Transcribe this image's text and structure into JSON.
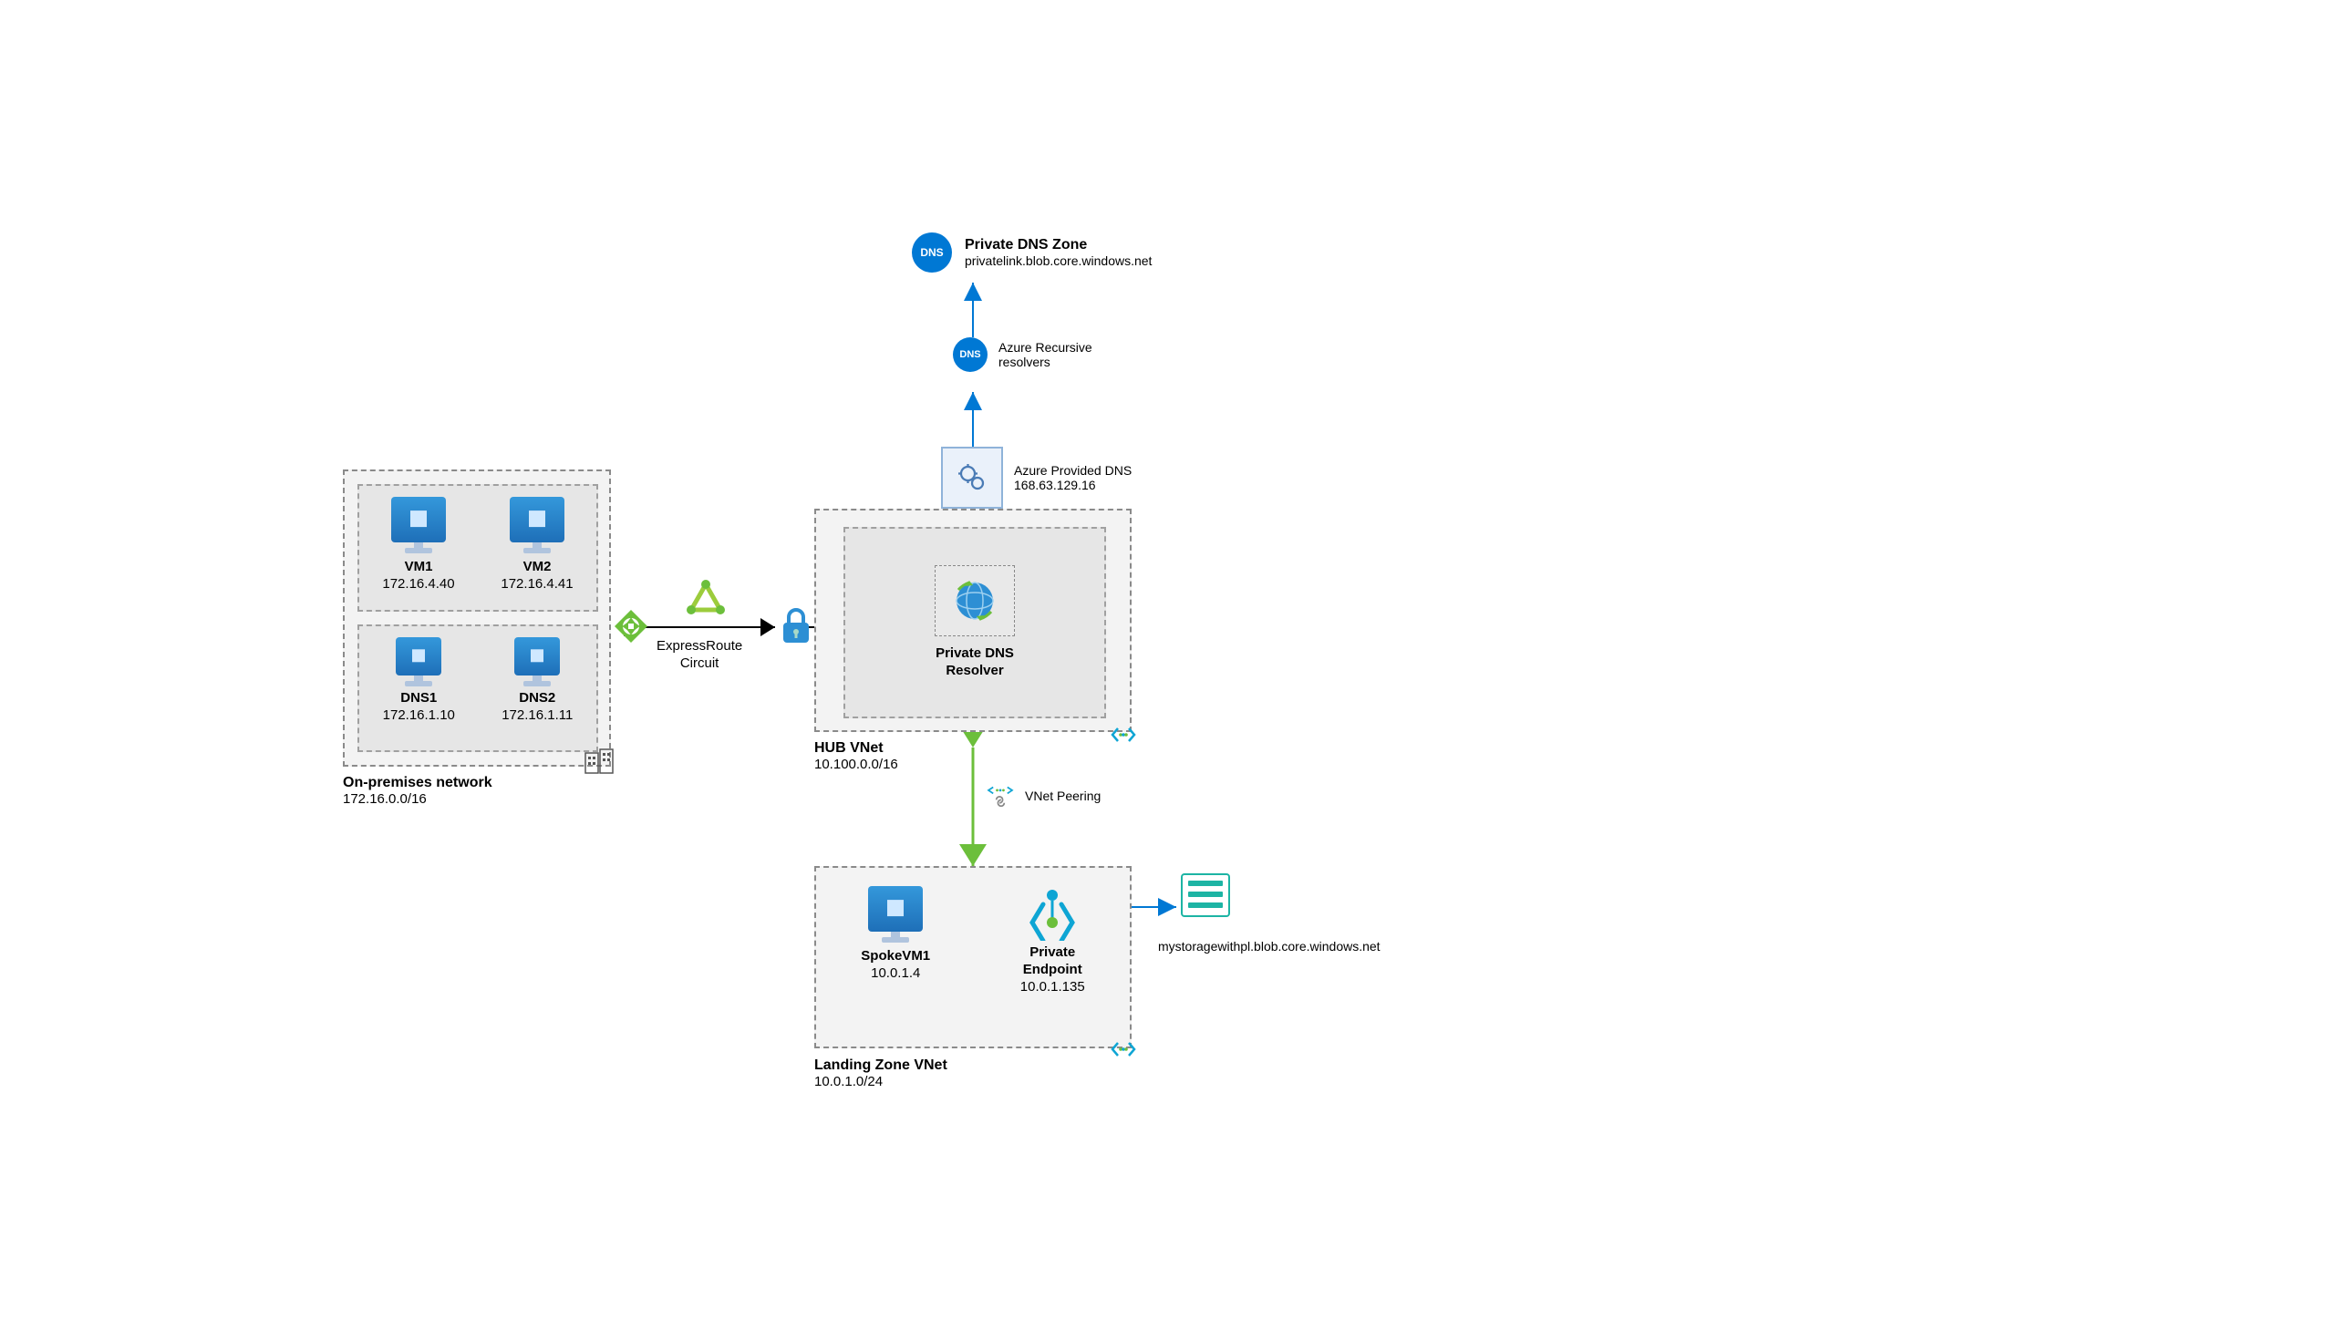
{
  "onprem": {
    "title": "On-premises network",
    "cidr": "172.16.0.0/16",
    "vm1": {
      "name": "VM1",
      "ip": "172.16.4.40"
    },
    "vm2": {
      "name": "VM2",
      "ip": "172.16.4.41"
    },
    "dns1": {
      "name": "DNS1",
      "ip": "172.16.1.10"
    },
    "dns2": {
      "name": "DNS2",
      "ip": "172.16.1.11"
    }
  },
  "expressroute": {
    "label": "ExpressRoute\nCircuit"
  },
  "hub": {
    "title": "HUB VNet",
    "cidr": "10.100.0.0/16",
    "resolver": "Private DNS\nResolver"
  },
  "azure_dns": {
    "label": "Azure Provided DNS",
    "ip": "168.63.129.16"
  },
  "recursive": {
    "label": "Azure Recursive\nresolvers"
  },
  "private_zone": {
    "title": "Private DNS Zone",
    "fqdn": "privatelink.blob.core.windows.net"
  },
  "peering": {
    "label": "VNet Peering"
  },
  "spoke": {
    "title": "Landing Zone VNet",
    "cidr": "10.0.1.0/24",
    "vm": {
      "name": "SpokeVM1",
      "ip": "10.0.1.4"
    },
    "endpoint": {
      "name": "Private\nEndpoint",
      "ip": "10.0.1.135"
    }
  },
  "storage": {
    "fqdn": "mystoragewithpl.blob.core.windows.net"
  }
}
